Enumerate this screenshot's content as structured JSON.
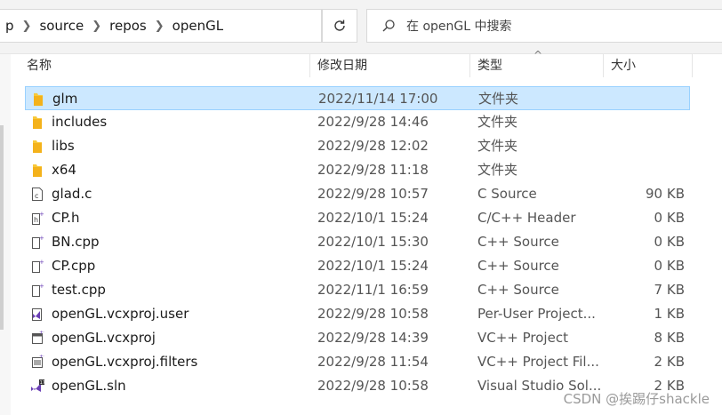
{
  "breadcrumb": [
    "p",
    "source",
    "repos",
    "openGL"
  ],
  "search": {
    "placeholder": "在 openGL 中搜索"
  },
  "columns": {
    "name": "名称",
    "date": "修改日期",
    "type": "类型",
    "size": "大小"
  },
  "files": [
    {
      "name": "glm",
      "date": "2022/11/14 17:00",
      "type": "文件夹",
      "size": "",
      "icon": "folder-icon",
      "selected": true
    },
    {
      "name": "includes",
      "date": "2022/9/28 14:46",
      "type": "文件夹",
      "size": "",
      "icon": "folder-icon"
    },
    {
      "name": "libs",
      "date": "2022/9/28 12:02",
      "type": "文件夹",
      "size": "",
      "icon": "folder-icon"
    },
    {
      "name": "x64",
      "date": "2022/9/28 11:18",
      "type": "文件夹",
      "size": "",
      "icon": "folder-icon"
    },
    {
      "name": "glad.c",
      "date": "2022/9/28 10:57",
      "type": "C Source",
      "size": "90 KB",
      "icon": "c-file-icon"
    },
    {
      "name": "CP.h",
      "date": "2022/10/1 15:24",
      "type": "C/C++ Header",
      "size": "0 KB",
      "icon": "header-file-icon"
    },
    {
      "name": "BN.cpp",
      "date": "2022/10/1 15:30",
      "type": "C++ Source",
      "size": "0 KB",
      "icon": "cpp-file-icon"
    },
    {
      "name": "CP.cpp",
      "date": "2022/10/1 15:24",
      "type": "C++ Source",
      "size": "0 KB",
      "icon": "cpp-file-icon"
    },
    {
      "name": "test.cpp",
      "date": "2022/11/1 16:59",
      "type": "C++ Source",
      "size": "7 KB",
      "icon": "cpp-file-icon"
    },
    {
      "name": "openGL.vcxproj.user",
      "date": "2022/9/28 10:58",
      "type": "Per-User Project...",
      "size": "1 KB",
      "icon": "vs-user-file-icon"
    },
    {
      "name": "openGL.vcxproj",
      "date": "2022/9/28 14:39",
      "type": "VC++ Project",
      "size": "8 KB",
      "icon": "vcxproj-file-icon"
    },
    {
      "name": "openGL.vcxproj.filters",
      "date": "2022/9/28 11:54",
      "type": "VC++ Project Fil...",
      "size": "2 KB",
      "icon": "filters-file-icon"
    },
    {
      "name": "openGL.sln",
      "date": "2022/9/28 10:58",
      "type": "Visual Studio Sol...",
      "size": "2 KB",
      "icon": "sln-file-icon"
    }
  ],
  "watermark": "CSDN @挨踢仔shackle",
  "colors": {
    "selection": "#cce8ff",
    "selection_border": "#99d1ff",
    "folder": "#f8c93b",
    "vs_purple": "#6a3fb5"
  }
}
